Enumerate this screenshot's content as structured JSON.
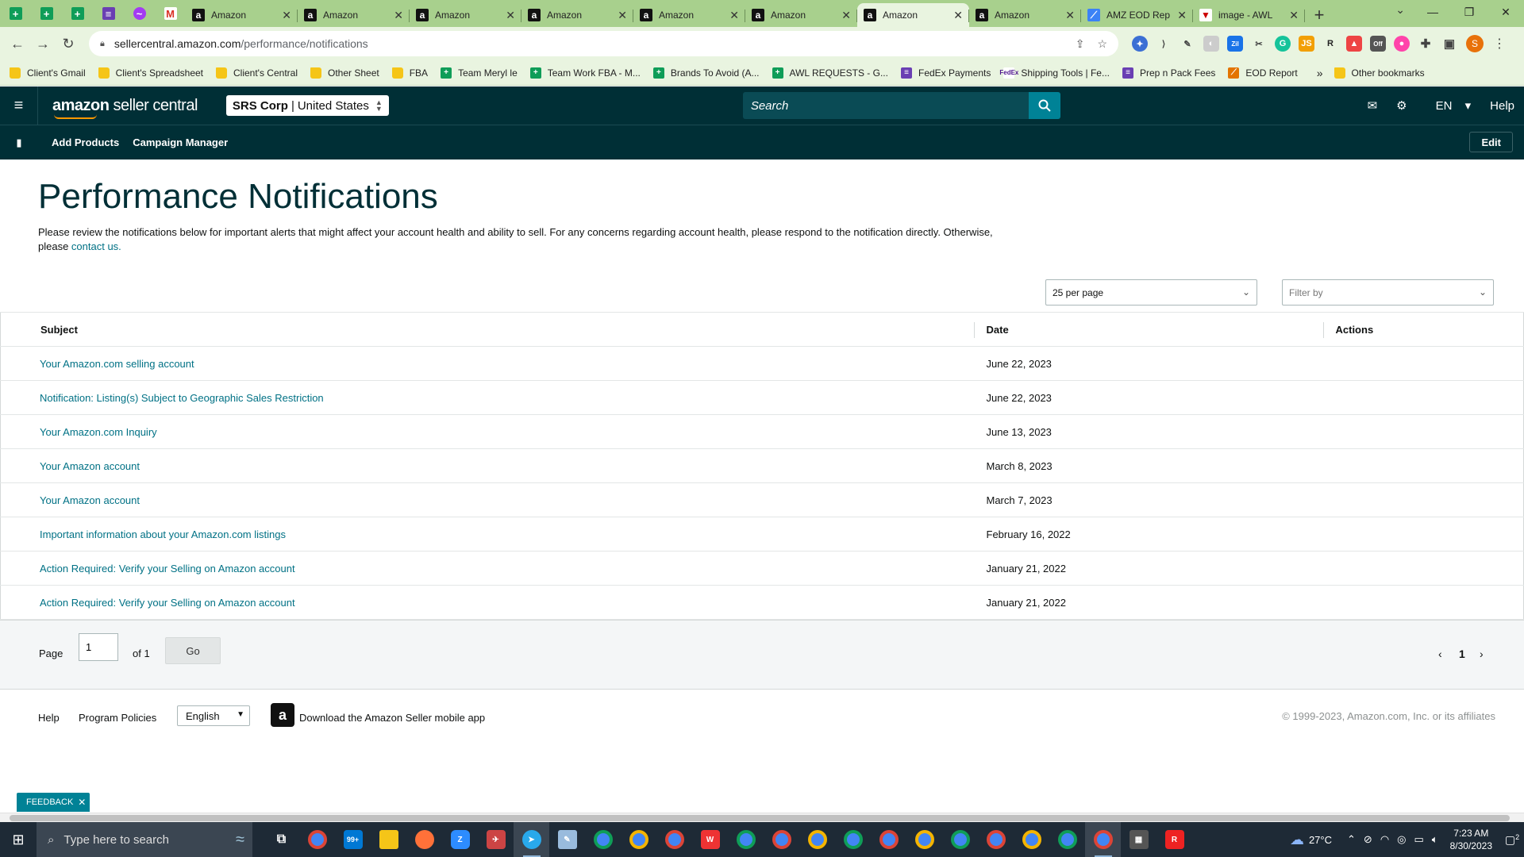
{
  "browser": {
    "tabs": [
      {
        "title": "Amazon",
        "active": false
      },
      {
        "title": "Amazon",
        "active": false
      },
      {
        "title": "Amazon",
        "active": false
      },
      {
        "title": "Amazon",
        "active": false
      },
      {
        "title": "Amazon",
        "active": false
      },
      {
        "title": "Amazon",
        "active": false
      },
      {
        "title": "Amazon",
        "active": true
      },
      {
        "title": "Amazon",
        "active": false
      },
      {
        "title": "AMZ EOD Rep",
        "active": false
      },
      {
        "title": "image - AWL",
        "active": false
      }
    ],
    "url_host": "sellercentral.amazon.com",
    "url_path": "/performance/notifications",
    "profile_initial": "S",
    "bookmarks": [
      {
        "label": "Client's Gmail",
        "icon": "folder-icon"
      },
      {
        "label": "Client's Spreadsheet",
        "icon": "folder-icon"
      },
      {
        "label": "Client's Central",
        "icon": "folder-icon"
      },
      {
        "label": "Other Sheet",
        "icon": "folder-icon"
      },
      {
        "label": "FBA",
        "icon": "folder-icon"
      },
      {
        "label": "Team Meryl le",
        "icon": "sheets-icon"
      },
      {
        "label": "Team Work FBA - M...",
        "icon": "sheets-icon"
      },
      {
        "label": "Brands To Avoid (A...",
        "icon": "sheets-icon"
      },
      {
        "label": "AWL REQUESTS - G...",
        "icon": "sheets-icon"
      },
      {
        "label": "FedEx Payments",
        "icon": "forms-icon"
      },
      {
        "label": "Shipping Tools | Fe...",
        "icon": "fedex-icon"
      },
      {
        "label": "Prep n Pack Fees",
        "icon": "forms-icon"
      },
      {
        "label": "EOD Report",
        "icon": "chart-icon"
      }
    ],
    "other_bookmarks": "Other bookmarks"
  },
  "header": {
    "logo_brand": "amazon",
    "logo_suffix": "seller central",
    "account_name": "SRS Corp",
    "marketplace": "United States",
    "search_placeholder": "Search",
    "language": "EN",
    "help": "Help"
  },
  "subnav": {
    "links": [
      "Add Products",
      "Campaign Manager"
    ],
    "edit": "Edit"
  },
  "page": {
    "title": "Performance Notifications",
    "intro": "Please review the notifications below for important alerts that might affect your account health and ability to sell. For any concerns regarding account health, please respond to the notification directly. Otherwise, please ",
    "intro_link": "contact us.",
    "per_page": "25 per page",
    "filter_placeholder": "Filter by"
  },
  "table": {
    "headers": {
      "subject": "Subject",
      "date": "Date",
      "actions": "Actions"
    },
    "rows": [
      {
        "subject": "Your Amazon.com selling account",
        "date": "June 22, 2023"
      },
      {
        "subject": "Notification: Listing(s) Subject to Geographic Sales Restriction",
        "date": "June 22, 2023"
      },
      {
        "subject": "Your Amazon.com Inquiry",
        "date": "June 13, 2023"
      },
      {
        "subject": "Your Amazon account",
        "date": "March 8, 2023"
      },
      {
        "subject": "Your Amazon account",
        "date": "March 7, 2023"
      },
      {
        "subject": "Important information about your Amazon.com listings",
        "date": "February 16, 2022"
      },
      {
        "subject": "Action Required: Verify your Selling on Amazon account",
        "date": "January 21, 2022"
      },
      {
        "subject": "Action Required: Verify your Selling on Amazon account",
        "date": "January 21, 2022"
      }
    ]
  },
  "pager": {
    "page_label": "Page",
    "page_value": "1",
    "of_label": "of 1",
    "go": "Go",
    "current": "1"
  },
  "footer": {
    "help": "Help",
    "policies": "Program Policies",
    "language": "English",
    "app_link": "Download the Amazon Seller mobile app",
    "copyright": "© 1999-2023, Amazon.com, Inc. or its affiliates"
  },
  "feedback": "FEEDBACK",
  "taskbar": {
    "search_placeholder": "Type here to search",
    "mail_badge": "99+",
    "temperature": "27°C",
    "time": "7:23 AM",
    "date": "8/30/2023",
    "notifications": "2"
  },
  "colors": {
    "amazon_header": "#002f36",
    "link": "#007185",
    "search_button": "#008296",
    "chrome_frame": "#a8d08d"
  }
}
